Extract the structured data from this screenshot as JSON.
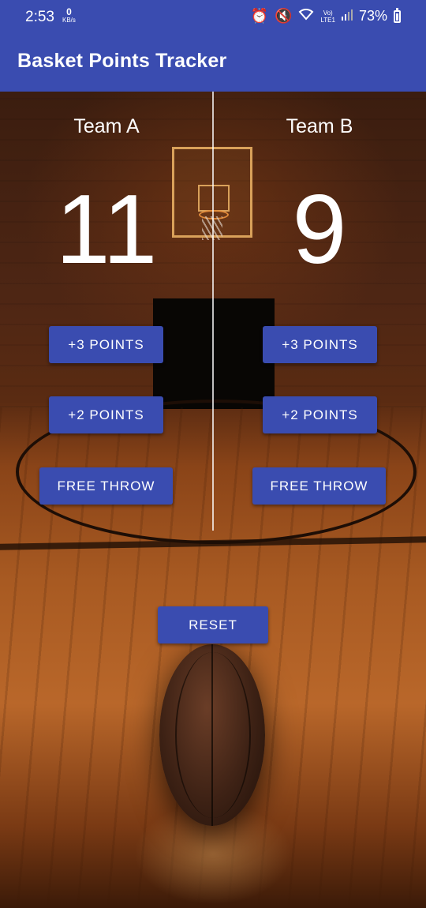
{
  "status_bar": {
    "time": "2:53",
    "net_speed_value": "0",
    "net_speed_unit": "KB/s",
    "network_label_top": "Vo)",
    "network_label_bottom": "LTE1",
    "battery_percent": "73%"
  },
  "app_bar": {
    "title": "Basket Points Tracker"
  },
  "team_a": {
    "name": "Team A",
    "score": "11",
    "btn_three": "+3 POINTS",
    "btn_two": "+2 POINTS",
    "btn_free": "FREE THROW"
  },
  "team_b": {
    "name": "Team B",
    "score": "9",
    "btn_three": "+3 POINTS",
    "btn_two": "+2 POINTS",
    "btn_free": "FREE THROW"
  },
  "reset_label": "RESET",
  "colors": {
    "primary": "#3a4cb0",
    "text_light": "#ffffff"
  }
}
